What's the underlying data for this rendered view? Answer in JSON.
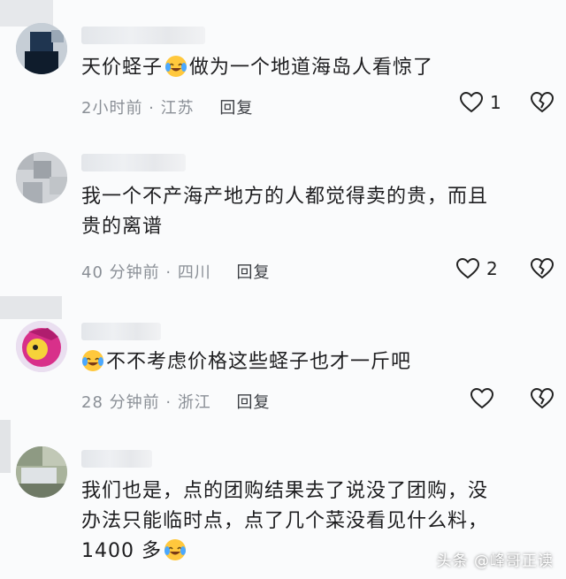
{
  "comments": [
    {
      "text_parts": [
        "天价蛏子",
        "做为一个地道海岛人看惊了"
      ],
      "time": "2小时前",
      "location": "江苏",
      "reply_label": "回复",
      "like_count": "1"
    },
    {
      "text_lines": [
        "我一个不产海产地方的人都觉得卖的贵，而且",
        "贵的离谱"
      ],
      "time": "40 分钟前",
      "location": "四川",
      "reply_label": "回复",
      "like_count": "2"
    },
    {
      "text_parts": [
        "不不考虑价格这些蛏子也才一斤吧"
      ],
      "time": "28 分钟前",
      "location": "浙江",
      "reply_label": "回复",
      "like_count": ""
    },
    {
      "text_lines": [
        "我们也是，点的团购结果去了说没了团购，没",
        "办法只能临时点，点了几个菜没看见什么料，"
      ],
      "text_tail": "1400 多"
    }
  ],
  "meta_separator": " · ",
  "icons": {
    "like": "heart-outline-icon",
    "dislike": "broken-heart-icon",
    "emoji_laugh": "laughing-crying-emoji-icon"
  },
  "watermark": "头条 @峰哥正读"
}
